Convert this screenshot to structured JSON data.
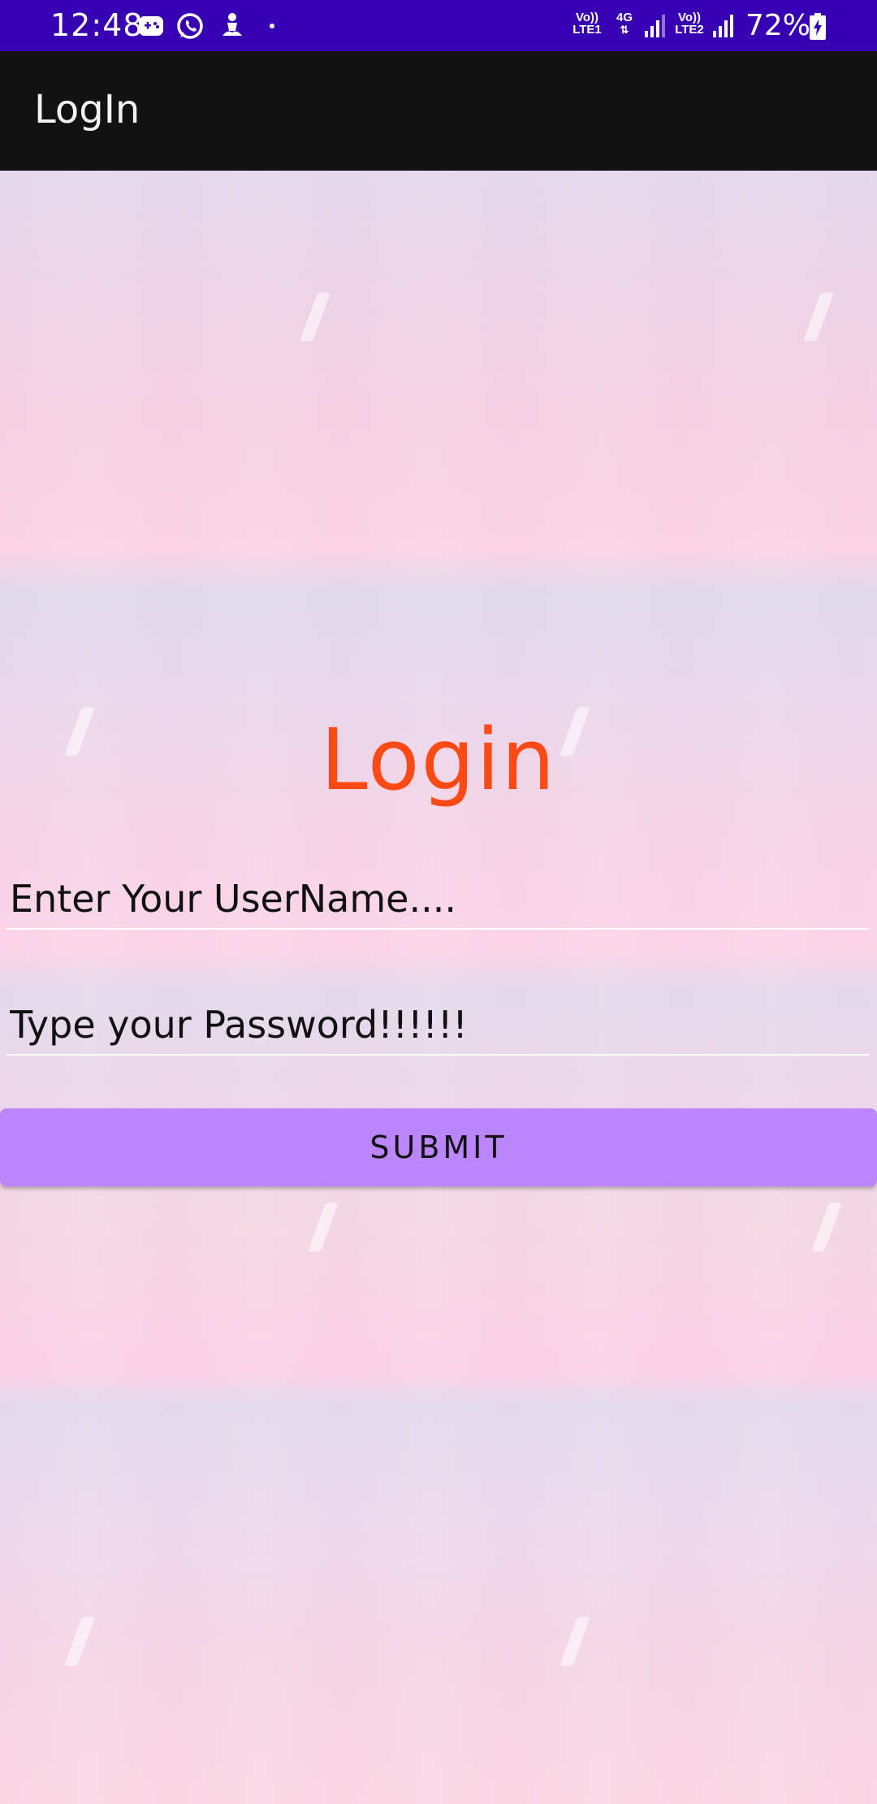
{
  "status_bar": {
    "time": "12:48",
    "icons": [
      "game-icon",
      "whatsapp-icon",
      "person-icon",
      "dot-icon"
    ],
    "sim1_label_top": "Vo))",
    "sim1_label_bottom": "LTE1",
    "network_type": "4G",
    "sim2_label_top": "Vo))",
    "sim2_label_bottom": "LTE2",
    "battery_percent": "72%",
    "battery_level": 0.72,
    "background_color": "#3700b3"
  },
  "app_bar": {
    "title": "LogIn",
    "background_color": "#121212"
  },
  "login": {
    "heading": "Login",
    "heading_color": "#ff4a16",
    "username_placeholder": "Enter Your UserName....",
    "password_placeholder": "Type your Password!!!!!!",
    "submit_label": "SUBMIT",
    "submit_color": "#bb86fc"
  }
}
